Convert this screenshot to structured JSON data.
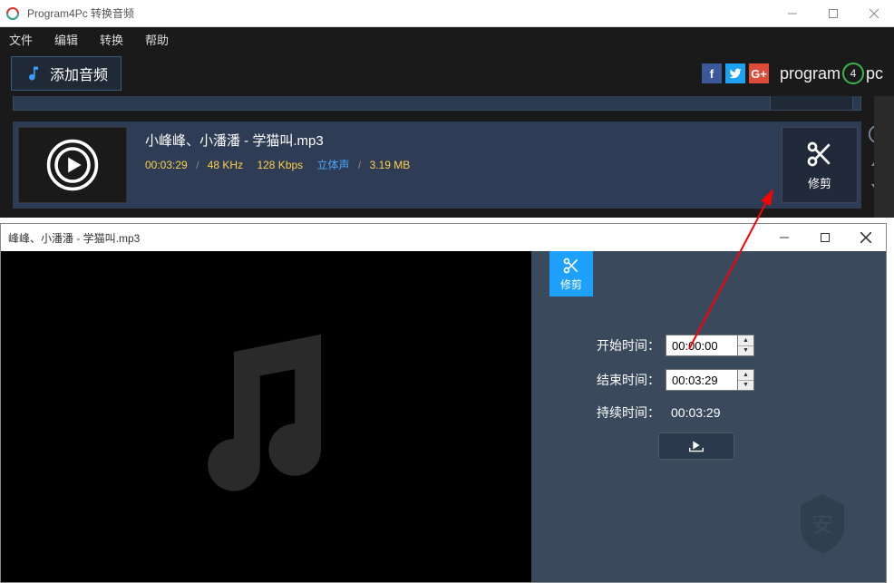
{
  "window": {
    "title": "Program4Pc 转换音频"
  },
  "menu": {
    "file": "文件",
    "edit": "编辑",
    "convert": "转换",
    "help": "帮助"
  },
  "toolbar": {
    "add_audio": "添加音频",
    "brand_pre": "program",
    "brand_four": "4",
    "brand_post": "pc"
  },
  "file": {
    "name": "小峰峰、小潘潘 - 学猫叫.mp3",
    "duration": "00:03:29",
    "khz": "48 KHz",
    "kbps": "128 Kbps",
    "stereo": "立体声",
    "size": "3.19 MB"
  },
  "trim_btn": {
    "label": "修剪"
  },
  "trim_window": {
    "title": "峰峰、小潘潘 - 学猫叫.mp3",
    "tab_label": "修剪",
    "start_label": "开始时间：",
    "end_label": "结束时间：",
    "duration_label": "持续时间：",
    "start_value": "00:00:00",
    "end_value": "00:03:29",
    "duration_value": "00:03:29"
  },
  "colors": {
    "accent": "#1ea0ff",
    "gold": "#ffcf4a",
    "panel": "#3a4a5c"
  }
}
